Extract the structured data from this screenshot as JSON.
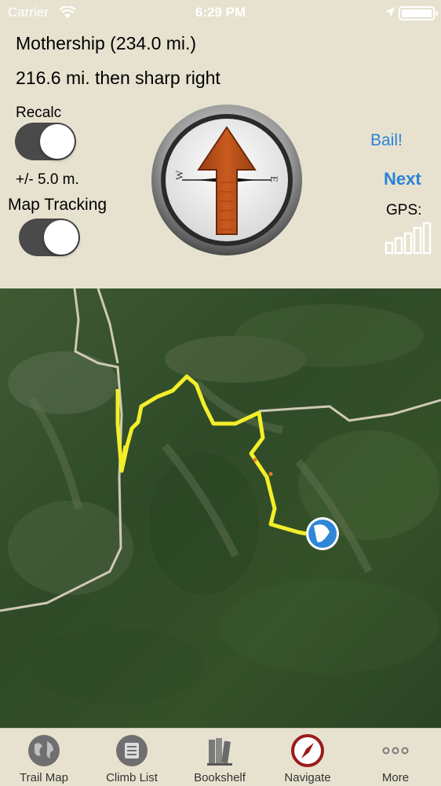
{
  "status_bar": {
    "carrier": "Carrier",
    "time": "6:29 PM"
  },
  "navigation": {
    "destination": "Mothership (234.0 mi.)",
    "instruction": "216.6 mi. then sharp right",
    "recalc_label": "Recalc",
    "recalc_on": true,
    "accuracy": "+/- 5.0 m.",
    "map_tracking_label": "Map Tracking",
    "map_tracking_on": true,
    "bail_label": "Bail!",
    "next_label": "Next",
    "gps_label": "GPS:",
    "gps_signal_level": 5,
    "gps_signal_max": 5,
    "compass_letters": {
      "west": "W",
      "east": "E"
    }
  },
  "tab_bar": {
    "tabs": [
      {
        "label": "Trail Map",
        "icon": "globe-icon"
      },
      {
        "label": "Climb List",
        "icon": "list-icon"
      },
      {
        "label": "Bookshelf",
        "icon": "books-icon"
      },
      {
        "label": "Navigate",
        "icon": "compass-icon"
      },
      {
        "label": "More",
        "icon": "more-icon"
      }
    ]
  },
  "colors": {
    "panel_background": "#e7e2d0",
    "accent_blue": "#2b83d6",
    "route_yellow": "#f2ee2a",
    "arrow_brown": "#b8501a",
    "navigate_red": "#9b1b1b",
    "toggle_on": "#4a4a4a"
  }
}
